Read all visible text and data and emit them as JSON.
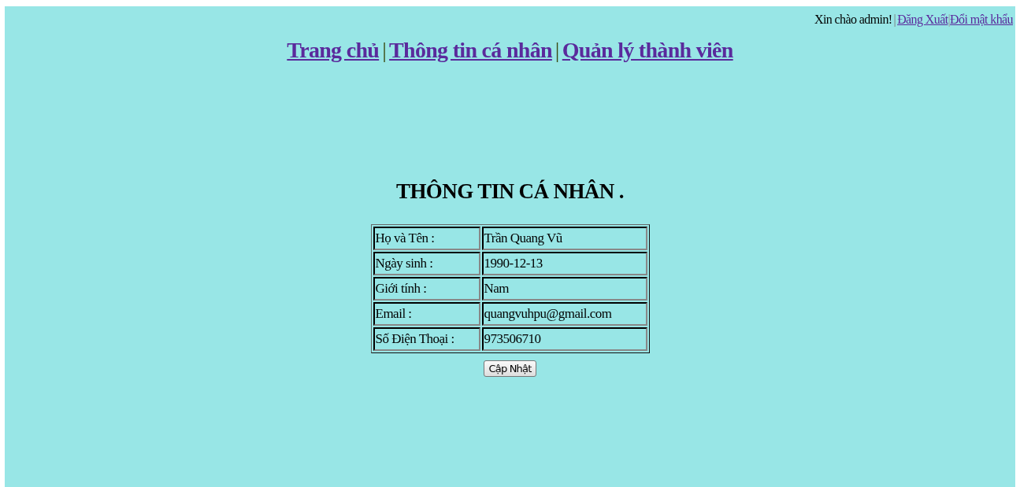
{
  "header": {
    "greeting": "Xin chào admin!",
    "separator": "|",
    "links": [
      {
        "label": "Đăng Xuất"
      },
      {
        "label": "Đổi mật khẩu"
      }
    ],
    "link_separator": "|"
  },
  "nav": {
    "items": [
      {
        "kind": "link",
        "label": "Trang chủ"
      },
      {
        "kind": "separator",
        "label": "|"
      },
      {
        "kind": "link",
        "label": "Thông tin cá nhân"
      },
      {
        "kind": "separator",
        "label": "|"
      },
      {
        "kind": "link",
        "label": "Quản lý thành viên"
      }
    ]
  },
  "heading": "THÔNG TIN CÁ NHÂN .",
  "profile": {
    "rows": [
      {
        "label": "Họ và Tên :",
        "value": "Trần Quang Vũ"
      },
      {
        "label": "Ngày sinh :",
        "value": "1990-12-13"
      },
      {
        "label": "Giới tính :",
        "value": "Nam"
      },
      {
        "label": "Email :",
        "value": "quangvuhpu@gmail.com"
      },
      {
        "label": "Số Điện Thoại :",
        "value": "973506710"
      }
    ]
  },
  "button": "Cập Nhật"
}
